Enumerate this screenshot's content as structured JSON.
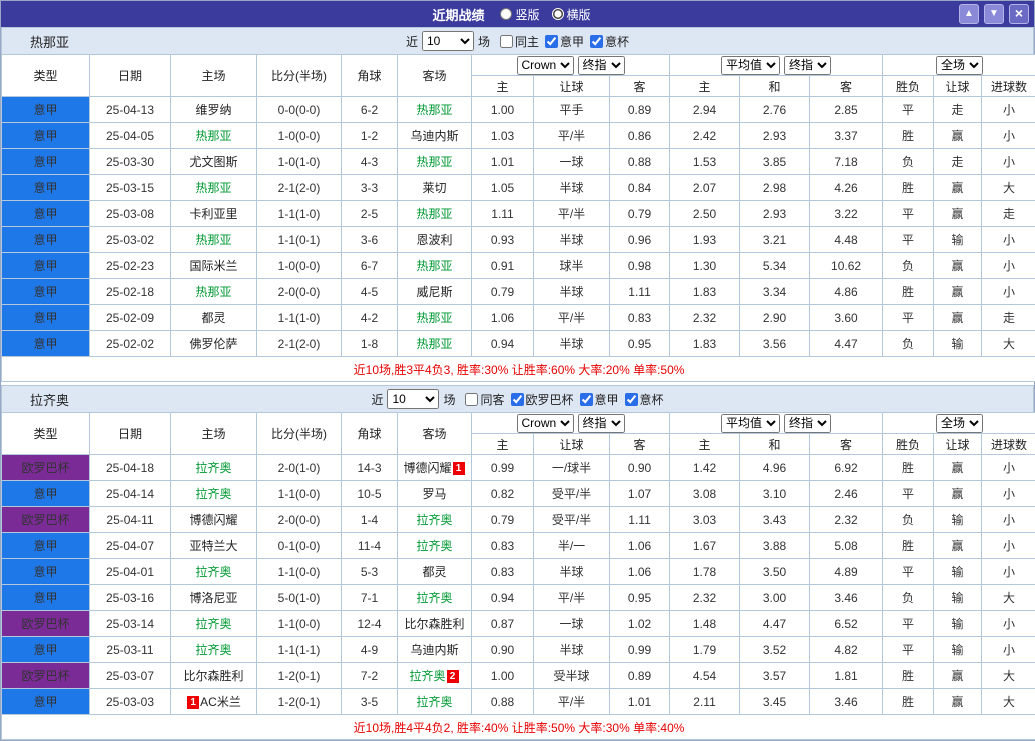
{
  "titlebar": {
    "title": "近期战绩",
    "layout_options": [
      {
        "label": "竖版",
        "selected": false
      },
      {
        "label": "横版",
        "selected": true
      }
    ],
    "buttons": {
      "up": "▲",
      "down": "▼",
      "close": "×"
    }
  },
  "colors": {
    "accent": "#3b3b9e",
    "serie_a_badge": "#1f78e8",
    "europa_badge": "#7b2b96",
    "team_highlight": "#009933",
    "score_red": "#ff0000",
    "win_red": "#ff0000",
    "draw_loss_green": "#009933",
    "lose_purple": "#9900cc",
    "summary_red": "#e60000"
  },
  "table_header": {
    "columns": [
      "类型",
      "日期",
      "主场",
      "比分(半场)",
      "角球",
      "客场"
    ],
    "asia_group": {
      "bookmaker": "Crown",
      "stage": "终指"
    },
    "europe_group": {
      "average": "平均值",
      "stage": "终指"
    },
    "result_group": {
      "scope": "全场"
    },
    "sub_columns": [
      "主",
      "让球",
      "客",
      "主",
      "和",
      "客",
      "胜负",
      "让球",
      "进球数"
    ]
  },
  "sections": [
    {
      "team": "热那亚",
      "filter": {
        "near_label": "近",
        "count": "10",
        "games_label": "场",
        "checkboxes": [
          {
            "label": "同主",
            "checked": false
          },
          {
            "label": "意甲",
            "checked": true
          },
          {
            "label": "意杯",
            "checked": true
          }
        ]
      },
      "rows": [
        {
          "league": "意甲",
          "league_color": "blue",
          "date": "25-04-13",
          "home": "维罗纳",
          "home_active": false,
          "home_card": "",
          "score": "0-0(0-0)",
          "corner": "6-2",
          "away": "热那亚",
          "away_active": true,
          "away_card": "",
          "asia_home": "1.00",
          "handicap": "平手",
          "asia_away": "0.89",
          "eu_home": "2.94",
          "eu_draw": "2.76",
          "eu_away": "2.85",
          "result": "平",
          "result_color": "green",
          "handicap_result": "走",
          "handicap_result_color": "green",
          "goals_result": "小",
          "goals_result_color": "green"
        },
        {
          "league": "意甲",
          "league_color": "blue",
          "date": "25-04-05",
          "home": "热那亚",
          "home_active": true,
          "home_card": "",
          "score": "1-0(0-0)",
          "corner": "1-2",
          "away": "乌迪内斯",
          "away_active": false,
          "away_card": "",
          "asia_home": "1.03",
          "handicap": "平/半",
          "asia_away": "0.86",
          "eu_home": "2.42",
          "eu_draw": "2.93",
          "eu_away": "3.37",
          "result": "胜",
          "result_color": "red",
          "handicap_result": "赢",
          "handicap_result_color": "red",
          "goals_result": "小",
          "goals_result_color": "green"
        },
        {
          "league": "意甲",
          "league_color": "blue",
          "date": "25-03-30",
          "home": "尤文图斯",
          "home_active": false,
          "home_card": "",
          "score": "1-0(1-0)",
          "corner": "4-3",
          "away": "热那亚",
          "away_active": true,
          "away_card": "",
          "asia_home": "1.01",
          "handicap": "一球",
          "asia_away": "0.88",
          "eu_home": "1.53",
          "eu_draw": "3.85",
          "eu_away": "7.18",
          "result": "负",
          "result_color": "green",
          "handicap_result": "走",
          "handicap_result_color": "green",
          "goals_result": "小",
          "goals_result_color": "green"
        },
        {
          "league": "意甲",
          "league_color": "blue",
          "date": "25-03-15",
          "home": "热那亚",
          "home_active": true,
          "home_card": "",
          "score": "2-1(2-0)",
          "corner": "3-3",
          "away": "莱切",
          "away_active": false,
          "away_card": "",
          "asia_home": "1.05",
          "handicap": "半球",
          "asia_away": "0.84",
          "eu_home": "2.07",
          "eu_draw": "2.98",
          "eu_away": "4.26",
          "result": "胜",
          "result_color": "red",
          "handicap_result": "赢",
          "handicap_result_color": "red",
          "goals_result": "大",
          "goals_result_color": "red"
        },
        {
          "league": "意甲",
          "league_color": "blue",
          "date": "25-03-08",
          "home": "卡利亚里",
          "home_active": false,
          "home_card": "",
          "score": "1-1(1-0)",
          "corner": "2-5",
          "away": "热那亚",
          "away_active": true,
          "away_card": "",
          "asia_home": "1.11",
          "handicap": "平/半",
          "asia_away": "0.79",
          "eu_home": "2.50",
          "eu_draw": "2.93",
          "eu_away": "3.22",
          "result": "平",
          "result_color": "green",
          "handicap_result": "赢",
          "handicap_result_color": "red",
          "goals_result": "走",
          "goals_result_color": "green"
        },
        {
          "league": "意甲",
          "league_color": "blue",
          "date": "25-03-02",
          "home": "热那亚",
          "home_active": true,
          "home_card": "",
          "score": "1-1(0-1)",
          "corner": "3-6",
          "away": "恩波利",
          "away_active": false,
          "away_card": "",
          "asia_home": "0.93",
          "handicap": "半球",
          "asia_away": "0.96",
          "eu_home": "1.93",
          "eu_draw": "3.21",
          "eu_away": "4.48",
          "result": "平",
          "result_color": "green",
          "handicap_result": "输",
          "handicap_result_color": "purple",
          "goals_result": "小",
          "goals_result_color": "green"
        },
        {
          "league": "意甲",
          "league_color": "blue",
          "date": "25-02-23",
          "home": "国际米兰",
          "home_active": false,
          "home_card": "",
          "score": "1-0(0-0)",
          "corner": "6-7",
          "away": "热那亚",
          "away_active": true,
          "away_card": "",
          "asia_home": "0.91",
          "handicap": "球半",
          "asia_away": "0.98",
          "eu_home": "1.30",
          "eu_draw": "5.34",
          "eu_away": "10.62",
          "result": "负",
          "result_color": "green",
          "handicap_result": "赢",
          "handicap_result_color": "red",
          "goals_result": "小",
          "goals_result_color": "green"
        },
        {
          "league": "意甲",
          "league_color": "blue",
          "date": "25-02-18",
          "home": "热那亚",
          "home_active": true,
          "home_card": "",
          "score": "2-0(0-0)",
          "corner": "4-5",
          "away": "威尼斯",
          "away_active": false,
          "away_card": "",
          "asia_home": "0.79",
          "handicap": "半球",
          "asia_away": "1.11",
          "eu_home": "1.83",
          "eu_draw": "3.34",
          "eu_away": "4.86",
          "result": "胜",
          "result_color": "red",
          "handicap_result": "赢",
          "handicap_result_color": "red",
          "goals_result": "小",
          "goals_result_color": "green"
        },
        {
          "league": "意甲",
          "league_color": "blue",
          "date": "25-02-09",
          "home": "都灵",
          "home_active": false,
          "home_card": "",
          "score": "1-1(1-0)",
          "corner": "4-2",
          "away": "热那亚",
          "away_active": true,
          "away_card": "",
          "asia_home": "1.06",
          "handicap": "平/半",
          "asia_away": "0.83",
          "eu_home": "2.32",
          "eu_draw": "2.90",
          "eu_away": "3.60",
          "result": "平",
          "result_color": "green",
          "handicap_result": "赢",
          "handicap_result_color": "red",
          "goals_result": "走",
          "goals_result_color": "green"
        },
        {
          "league": "意甲",
          "league_color": "blue",
          "date": "25-02-02",
          "home": "佛罗伦萨",
          "home_active": false,
          "home_card": "",
          "score": "2-1(2-0)",
          "corner": "1-8",
          "away": "热那亚",
          "away_active": true,
          "away_card": "",
          "asia_home": "0.94",
          "handicap": "半球",
          "asia_away": "0.95",
          "eu_home": "1.83",
          "eu_draw": "3.56",
          "eu_away": "4.47",
          "result": "负",
          "result_color": "green",
          "handicap_result": "输",
          "handicap_result_color": "purple",
          "goals_result": "大",
          "goals_result_color": "red"
        }
      ],
      "summary": "近10场,胜3平4负3, 胜率:30% 让胜率:60% 大率:20% 单率:50%"
    },
    {
      "team": "拉齐奥",
      "filter": {
        "near_label": "近",
        "count": "10",
        "games_label": "场",
        "checkboxes": [
          {
            "label": "同客",
            "checked": false
          },
          {
            "label": "欧罗巴杯",
            "checked": true
          },
          {
            "label": "意甲",
            "checked": true
          },
          {
            "label": "意杯",
            "checked": true
          }
        ]
      },
      "rows": [
        {
          "league": "欧罗巴杯",
          "league_color": "purple",
          "date": "25-04-18",
          "home": "拉齐奥",
          "home_active": true,
          "home_card": "",
          "score": "2-0(1-0)",
          "corner": "14-3",
          "away": "博德闪耀",
          "away_active": false,
          "away_card": "1",
          "asia_home": "0.99",
          "handicap": "一/球半",
          "asia_away": "0.90",
          "eu_home": "1.42",
          "eu_draw": "4.96",
          "eu_away": "6.92",
          "result": "胜",
          "result_color": "red",
          "handicap_result": "赢",
          "handicap_result_color": "red",
          "goals_result": "小",
          "goals_result_color": "green"
        },
        {
          "league": "意甲",
          "league_color": "blue",
          "date": "25-04-14",
          "home": "拉齐奥",
          "home_active": true,
          "home_card": "",
          "score": "1-1(0-0)",
          "corner": "10-5",
          "away": "罗马",
          "away_active": false,
          "away_card": "",
          "asia_home": "0.82",
          "handicap": "受平/半",
          "asia_away": "1.07",
          "eu_home": "3.08",
          "eu_draw": "3.10",
          "eu_away": "2.46",
          "result": "平",
          "result_color": "green",
          "handicap_result": "赢",
          "handicap_result_color": "red",
          "goals_result": "小",
          "goals_result_color": "green"
        },
        {
          "league": "欧罗巴杯",
          "league_color": "purple",
          "date": "25-04-11",
          "home": "博德闪耀",
          "home_active": false,
          "home_card": "",
          "score": "2-0(0-0)",
          "corner": "1-4",
          "away": "拉齐奥",
          "away_active": true,
          "away_card": "",
          "asia_home": "0.79",
          "handicap": "受平/半",
          "asia_away": "1.11",
          "eu_home": "3.03",
          "eu_draw": "3.43",
          "eu_away": "2.32",
          "result": "负",
          "result_color": "green",
          "handicap_result": "输",
          "handicap_result_color": "purple",
          "goals_result": "小",
          "goals_result_color": "green"
        },
        {
          "league": "意甲",
          "league_color": "blue",
          "date": "25-04-07",
          "home": "亚特兰大",
          "home_active": false,
          "home_card": "",
          "score": "0-1(0-0)",
          "corner": "11-4",
          "away": "拉齐奥",
          "away_active": true,
          "away_card": "",
          "asia_home": "0.83",
          "handicap": "半/一",
          "asia_away": "1.06",
          "eu_home": "1.67",
          "eu_draw": "3.88",
          "eu_away": "5.08",
          "result": "胜",
          "result_color": "red",
          "handicap_result": "赢",
          "handicap_result_color": "red",
          "goals_result": "小",
          "goals_result_color": "green"
        },
        {
          "league": "意甲",
          "league_color": "blue",
          "date": "25-04-01",
          "home": "拉齐奥",
          "home_active": true,
          "home_card": "",
          "score": "1-1(0-0)",
          "corner": "5-3",
          "away": "都灵",
          "away_active": false,
          "away_card": "",
          "asia_home": "0.83",
          "handicap": "半球",
          "asia_away": "1.06",
          "eu_home": "1.78",
          "eu_draw": "3.50",
          "eu_away": "4.89",
          "result": "平",
          "result_color": "green",
          "handicap_result": "输",
          "handicap_result_color": "purple",
          "goals_result": "小",
          "goals_result_color": "green"
        },
        {
          "league": "意甲",
          "league_color": "blue",
          "date": "25-03-16",
          "home": "博洛尼亚",
          "home_active": false,
          "home_card": "",
          "score": "5-0(1-0)",
          "corner": "7-1",
          "away": "拉齐奥",
          "away_active": true,
          "away_card": "",
          "asia_home": "0.94",
          "handicap": "平/半",
          "asia_away": "0.95",
          "eu_home": "2.32",
          "eu_draw": "3.00",
          "eu_away": "3.46",
          "result": "负",
          "result_color": "green",
          "handicap_result": "输",
          "handicap_result_color": "purple",
          "goals_result": "大",
          "goals_result_color": "red"
        },
        {
          "league": "欧罗巴杯",
          "league_color": "purple",
          "date": "25-03-14",
          "home": "拉齐奥",
          "home_active": true,
          "home_card": "",
          "score": "1-1(0-0)",
          "corner": "12-4",
          "away": "比尔森胜利",
          "away_active": false,
          "away_card": "",
          "asia_home": "0.87",
          "handicap": "一球",
          "asia_away": "1.02",
          "eu_home": "1.48",
          "eu_draw": "4.47",
          "eu_away": "6.52",
          "result": "平",
          "result_color": "green",
          "handicap_result": "输",
          "handicap_result_color": "purple",
          "goals_result": "小",
          "goals_result_color": "green"
        },
        {
          "league": "意甲",
          "league_color": "blue",
          "date": "25-03-11",
          "home": "拉齐奥",
          "home_active": true,
          "home_card": "",
          "score": "1-1(1-1)",
          "corner": "4-9",
          "away": "乌迪内斯",
          "away_active": false,
          "away_card": "",
          "asia_home": "0.90",
          "handicap": "半球",
          "asia_away": "0.99",
          "eu_home": "1.79",
          "eu_draw": "3.52",
          "eu_away": "4.82",
          "result": "平",
          "result_color": "green",
          "handicap_result": "输",
          "handicap_result_color": "purple",
          "goals_result": "小",
          "goals_result_color": "green"
        },
        {
          "league": "欧罗巴杯",
          "league_color": "purple",
          "date": "25-03-07",
          "home": "比尔森胜利",
          "home_active": false,
          "home_card": "",
          "score": "1-2(0-1)",
          "corner": "7-2",
          "away": "拉齐奥",
          "away_active": true,
          "away_card": "2",
          "asia_home": "1.00",
          "handicap": "受半球",
          "asia_away": "0.89",
          "eu_home": "4.54",
          "eu_draw": "3.57",
          "eu_away": "1.81",
          "result": "胜",
          "result_color": "red",
          "handicap_result": "赢",
          "handicap_result_color": "red",
          "goals_result": "大",
          "goals_result_color": "red"
        },
        {
          "league": "意甲",
          "league_color": "blue",
          "date": "25-03-03",
          "home": "AC米兰",
          "home_active": false,
          "home_card": "1",
          "score": "1-2(0-1)",
          "corner": "3-5",
          "away": "拉齐奥",
          "away_active": true,
          "away_card": "",
          "asia_home": "0.88",
          "handicap": "平/半",
          "asia_away": "1.01",
          "eu_home": "2.11",
          "eu_draw": "3.45",
          "eu_away": "3.46",
          "result": "胜",
          "result_color": "red",
          "handicap_result": "赢",
          "handicap_result_color": "red",
          "goals_result": "大",
          "goals_result_color": "red"
        }
      ],
      "summary": "近10场,胜4平4负2, 胜率:40% 让胜率:50% 大率:30% 单率:40%"
    }
  ]
}
